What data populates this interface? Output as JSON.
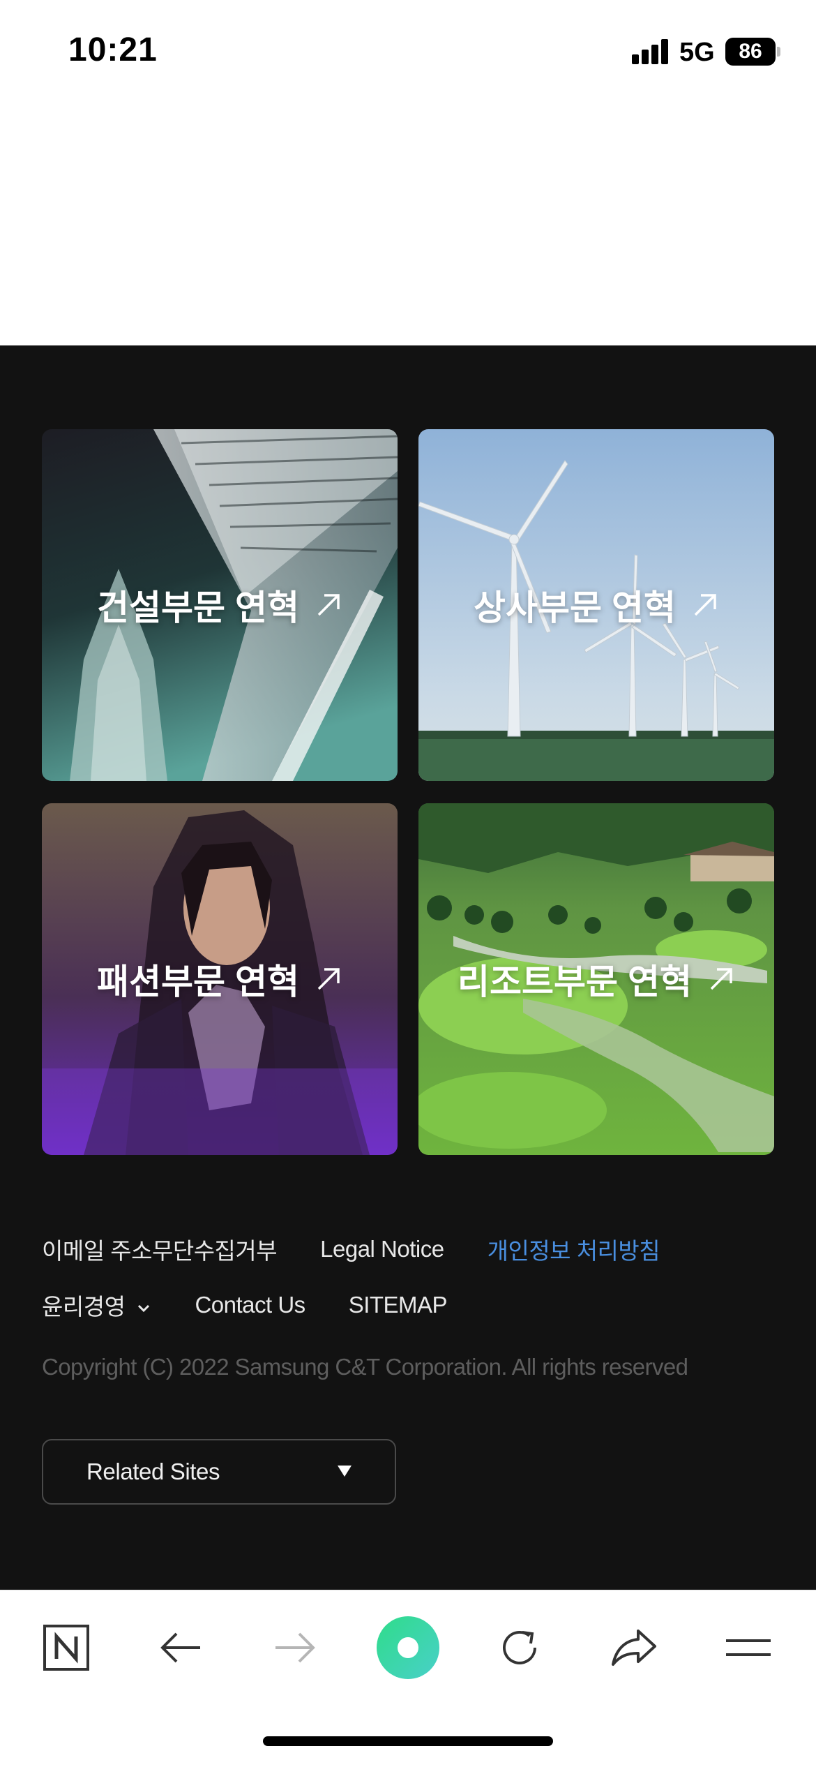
{
  "status_bar": {
    "time": "10:21",
    "network": "5G",
    "battery": "86"
  },
  "tiles": [
    {
      "label": "건설부문 연혁"
    },
    {
      "label": "상사부문 연혁"
    },
    {
      "label": "패션부문 연혁"
    },
    {
      "label": "리조트부문 연혁"
    }
  ],
  "footer": {
    "links_row1": [
      "이메일 주소무단수집거부",
      "Legal Notice",
      "개인정보 처리방침"
    ],
    "ethics_label": "윤리경영",
    "links_row2": [
      "Contact Us",
      "SITEMAP"
    ],
    "copyright": "Copyright (C) 2022 Samsung C&T Corporation. All rights reserved",
    "related_sites": "Related Sites"
  },
  "colors": {
    "footer_bg": "#121212",
    "link_highlight": "#4a8fe0",
    "toolbar_accent": "#3fd9a0"
  },
  "toolbar": {
    "icons": [
      "naver-n-icon",
      "back-arrow-icon",
      "forward-arrow-icon",
      "green-dot-icon",
      "reload-icon",
      "share-icon",
      "menu-icon"
    ]
  }
}
